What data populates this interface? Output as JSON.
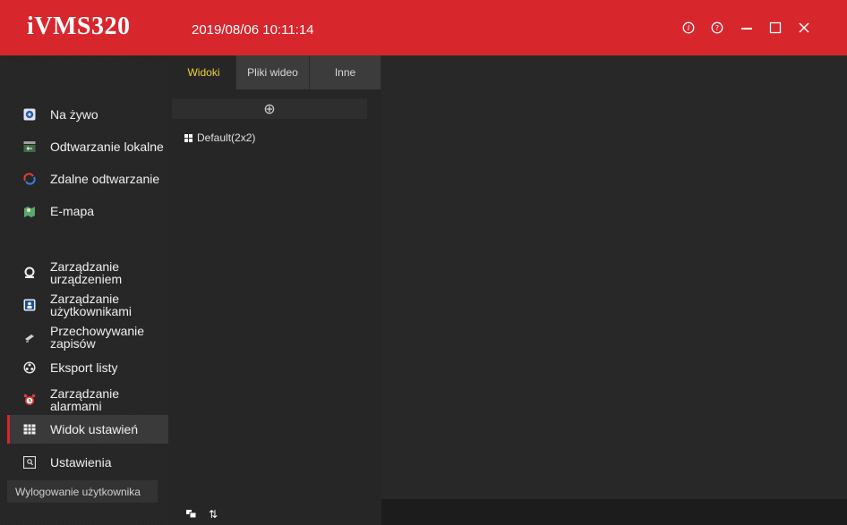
{
  "app": {
    "title": "iVMS320",
    "datetime": "2019/08/06 10:11:14"
  },
  "window_controls": [
    {
      "name": "about-icon",
      "glyph": "ⓘ"
    },
    {
      "name": "help-icon",
      "glyph": "⓪"
    },
    {
      "name": "minimize-icon",
      "glyph": "—"
    },
    {
      "name": "maximize-icon",
      "glyph": "□"
    },
    {
      "name": "close-icon",
      "glyph": "✕"
    }
  ],
  "sidebar": {
    "items": [
      {
        "label": "Na żywo",
        "icon": "live-view-icon"
      },
      {
        "label": "Odtwarzanie lokalne",
        "icon": "local-playback-icon"
      },
      {
        "label": "Zdalne odtwarzanie",
        "icon": "remote-playback-icon"
      },
      {
        "label": "E-mapa",
        "icon": "emap-icon"
      },
      {
        "label": "Zarządzanie urządzeniem",
        "line1": "Zarządzanie",
        "line2": "urządzeniem",
        "icon": "device-management-icon"
      },
      {
        "label": "Zarządzanie użytkownikami",
        "line1": "Zarządzanie",
        "line2": "użytkownikami",
        "icon": "user-management-icon"
      },
      {
        "label": "Przechowywanie zapisów",
        "line1": "Przechowywanie",
        "line2": "zapisów",
        "icon": "record-storage-icon"
      },
      {
        "label": "Eksport listy",
        "icon": "export-list-icon"
      },
      {
        "label": "Zarządzanie alarmami",
        "line1": "Zarządzanie",
        "line2": "alarmami",
        "icon": "alarm-management-icon"
      },
      {
        "label": "Widok ustawień",
        "icon": "view-settings-icon",
        "active": true
      },
      {
        "label": "Ustawienia",
        "icon": "settings-icon"
      }
    ],
    "logout_label": "Wylogowanie użytkownika"
  },
  "panel": {
    "tabs": [
      {
        "label": "Widoki",
        "active": true
      },
      {
        "label": "Pliki wideo",
        "active": false
      },
      {
        "label": "Inne",
        "active": false
      }
    ],
    "add_glyph": "⊕",
    "views": [
      {
        "label": "Default(2x2)",
        "icon": "grid-2x2-icon"
      }
    ],
    "bottom_tools": [
      {
        "name": "window-layout-icon"
      },
      {
        "name": "sort-icon",
        "glyph": "⇅"
      }
    ]
  },
  "colors": {
    "accent": "#d8262d",
    "active_tab_text": "#f3d23b",
    "background": "#1a1a1a"
  }
}
